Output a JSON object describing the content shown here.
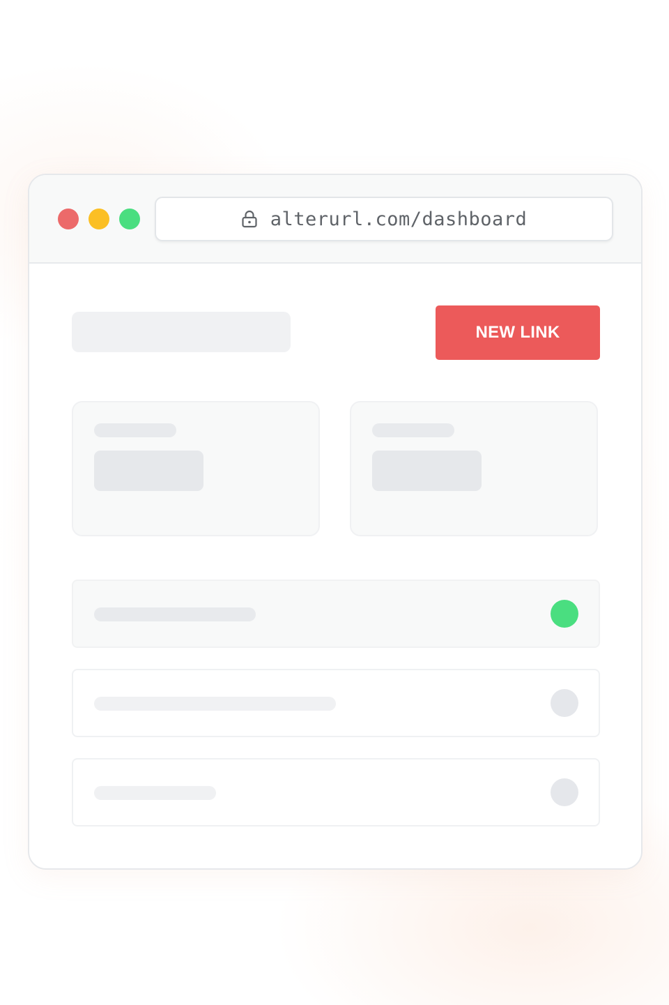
{
  "browser": {
    "url": "alterurl.com/dashboard",
    "lock_icon": "lock-icon",
    "traffic_lights": {
      "close_color": "#ec6a6a",
      "minimize_color": "#fbbf24",
      "maximize_color": "#4ade80"
    }
  },
  "header": {
    "new_link_label": "NEW LINK",
    "accent_color": "#ec5a5a"
  },
  "links": {
    "rows": [
      {
        "status": "active",
        "status_color": "#4ade80"
      },
      {
        "status": "inactive",
        "status_color": "#e5e7eb"
      },
      {
        "status": "inactive",
        "status_color": "#e5e7eb"
      }
    ]
  }
}
